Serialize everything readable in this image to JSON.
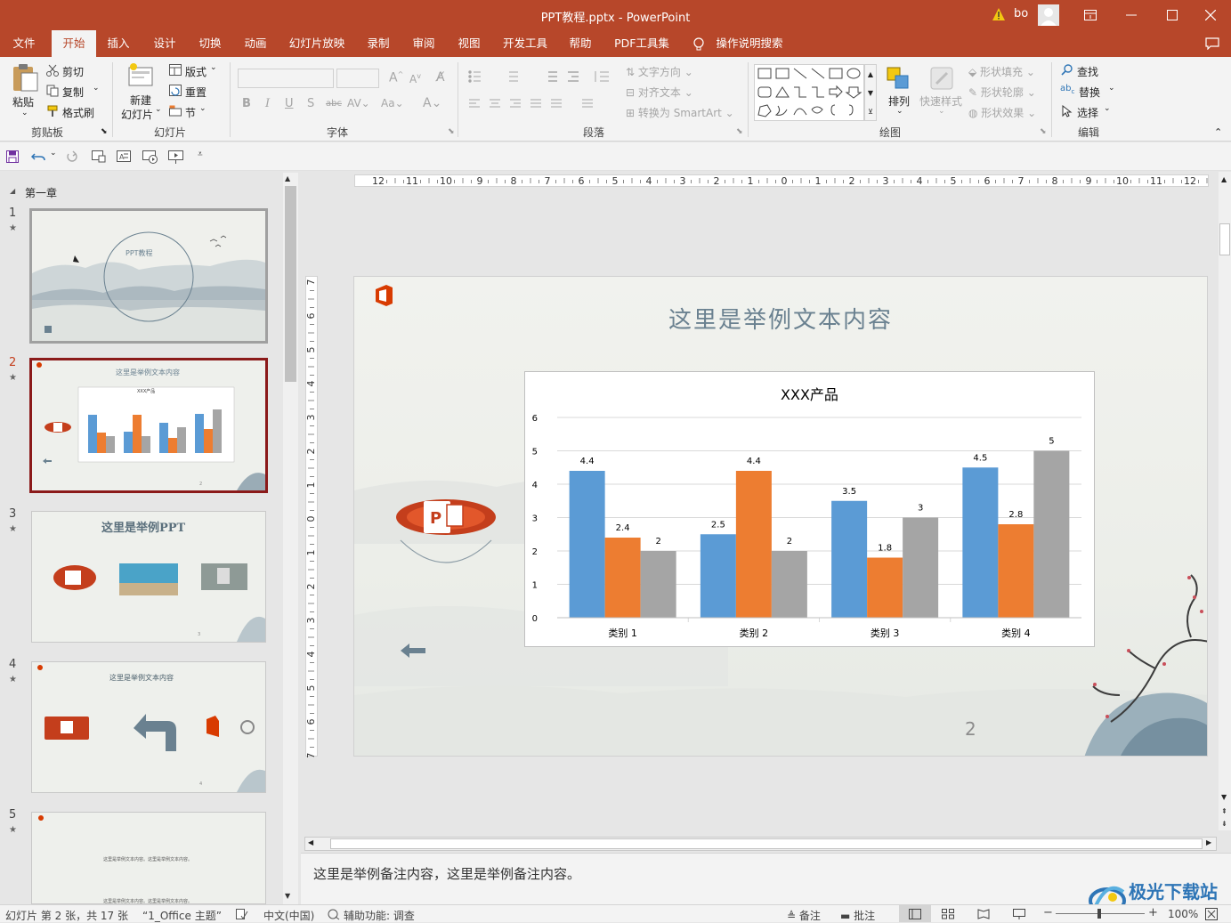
{
  "window": {
    "title": "PPT教程.pptx  -  PowerPoint",
    "user": "bo"
  },
  "tabs": [
    "文件",
    "开始",
    "插入",
    "设计",
    "切换",
    "动画",
    "幻灯片放映",
    "录制",
    "审阅",
    "视图",
    "开发工具",
    "帮助",
    "PDF工具集",
    "操作说明搜索"
  ],
  "active_tab": "开始",
  "ribbon": {
    "clipboard": {
      "label": "剪贴板",
      "paste": "粘贴",
      "cut": "剪切",
      "copy": "复制",
      "format_painter": "格式刷"
    },
    "slides": {
      "label": "幻灯片",
      "new_slide_line1": "新建",
      "new_slide_line2": "幻灯片",
      "layout": "版式",
      "reset": "重置",
      "section": "节"
    },
    "font": {
      "label": "字体"
    },
    "paragraph": {
      "label": "段落",
      "text_direction": "文字方向",
      "align_text": "对齐文本",
      "smartart": "转换为 SmartArt"
    },
    "drawing": {
      "label": "绘图",
      "arrange": "排列",
      "quick_styles": "快速样式",
      "shape_fill": "形状填充",
      "shape_outline": "形状轮廓",
      "shape_effects": "形状效果"
    },
    "editing": {
      "label": "编辑",
      "find": "查找",
      "replace": "替换",
      "select": "选择"
    }
  },
  "section_name": "第一章",
  "thumbnails": [
    {
      "num": "1",
      "title": "PPT教程"
    },
    {
      "num": "2",
      "title": "这里是举例文本内容",
      "chart_title": "XXX产品",
      "page": "2"
    },
    {
      "num": "3",
      "title": "这里是举例PPT",
      "page": "3"
    },
    {
      "num": "4",
      "title": "这里是举例文本内容",
      "page": "4"
    },
    {
      "num": "5",
      "line1": "这里是举例文本内容。这里是举例文本内容。",
      "line2": "这里是举例文本内容。这里是举例文本内容。"
    }
  ],
  "ruler": {
    "h_ticks": [
      "12",
      "11",
      "10",
      "9",
      "8",
      "7",
      "6",
      "5",
      "4",
      "3",
      "2",
      "1",
      "0",
      "1",
      "2",
      "3",
      "4",
      "5",
      "6",
      "7",
      "8",
      "9",
      "10",
      "11",
      "12"
    ],
    "v_ticks": [
      "7",
      "6",
      "5",
      "4",
      "3",
      "2",
      "1",
      "0",
      "1",
      "2",
      "3",
      "4",
      "5",
      "6",
      "7"
    ]
  },
  "slide": {
    "title": "这里是举例文本内容",
    "page_number": "2"
  },
  "chart_data": {
    "type": "bar",
    "title": "XXX产品",
    "categories": [
      "类别 1",
      "类别 2",
      "类别 3",
      "类别 4"
    ],
    "series": [
      {
        "values": [
          4.4,
          2.5,
          3.5,
          4.5
        ],
        "color": "#5b9bd5"
      },
      {
        "values": [
          2.4,
          4.4,
          1.8,
          2.8
        ],
        "color": "#ed7d31"
      },
      {
        "values": [
          2,
          2,
          3,
          5
        ],
        "color": "#a5a5a5"
      }
    ],
    "value_labels": [
      [
        "4.4",
        "2.5",
        "3.5",
        "4.5"
      ],
      [
        "2.4",
        "4.4",
        "1.8",
        "2.8"
      ],
      [
        "2",
        "2",
        "3",
        "5"
      ]
    ],
    "ylim": [
      0,
      6
    ],
    "yticks": [
      "0",
      "1",
      "2",
      "3",
      "4",
      "5",
      "6"
    ],
    "grid": true
  },
  "notes": "这里是举例备注内容，这里是举例备注内容。",
  "status": {
    "slide_info": "幻灯片 第 2 张，共 17 张",
    "theme": "“1_Office 主题”",
    "language": "中文(中国)",
    "accessibility": "辅助功能: 调查",
    "notes_btn": "备注",
    "comments_btn": "批注",
    "zoom": "100%"
  },
  "watermark": "极光下载站",
  "colors": {
    "accent": "#b7472a",
    "selected_border": "#8b1a1a"
  }
}
